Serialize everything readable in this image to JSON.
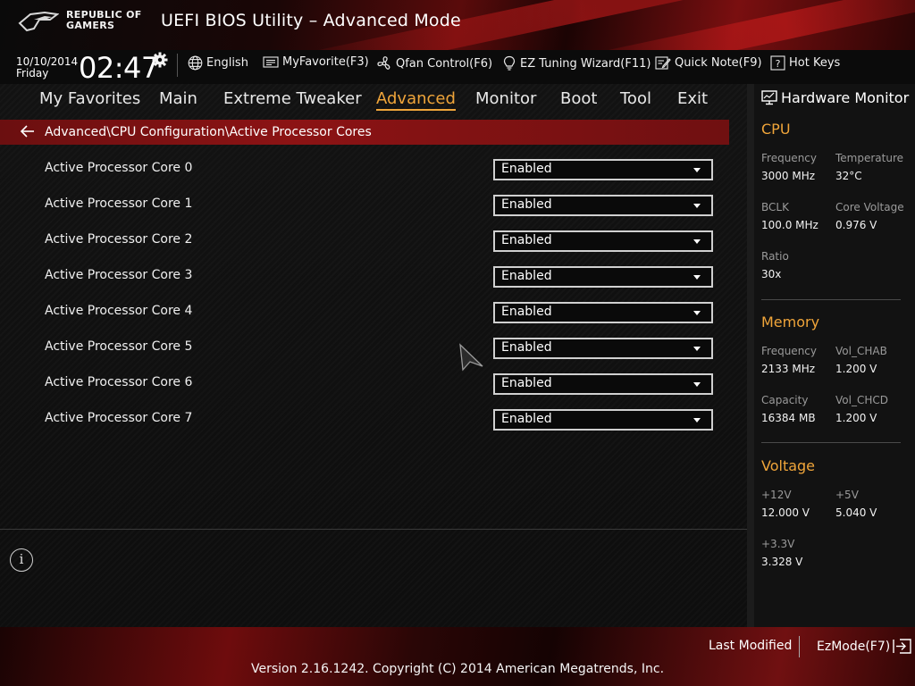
{
  "header": {
    "logo_line1": "REPUBLIC OF",
    "logo_line2": "GAMERS",
    "title": "UEFI BIOS Utility – Advanced Mode"
  },
  "infobar": {
    "date": "10/10/2014",
    "day": "Friday",
    "time": "02:47",
    "tools": [
      {
        "label": "English",
        "icon": "globe-icon"
      },
      {
        "label": "MyFavorite(F3)",
        "icon": "favorite-icon"
      },
      {
        "label": "Qfan Control(F6)",
        "icon": "fan-icon"
      },
      {
        "label": "EZ Tuning Wizard(F11)",
        "icon": "bulb-icon"
      },
      {
        "label": "Quick Note(F9)",
        "icon": "note-icon"
      },
      {
        "label": "Hot Keys",
        "icon": "question-icon"
      }
    ]
  },
  "nav": {
    "tabs": [
      {
        "label": "My Favorites"
      },
      {
        "label": "Main"
      },
      {
        "label": "Extreme Tweaker"
      },
      {
        "label": "Advanced",
        "active": true
      },
      {
        "label": "Monitor"
      },
      {
        "label": "Boot"
      },
      {
        "label": "Tool"
      },
      {
        "label": "Exit"
      }
    ]
  },
  "breadcrumb": "Advanced\\CPU Configuration\\Active Processor Cores",
  "settings": [
    {
      "label": "Active Processor Core 0",
      "value": "Enabled"
    },
    {
      "label": "Active Processor Core 1",
      "value": "Enabled"
    },
    {
      "label": "Active Processor Core 2",
      "value": "Enabled"
    },
    {
      "label": "Active Processor Core 3",
      "value": "Enabled"
    },
    {
      "label": "Active Processor Core 4",
      "value": "Enabled"
    },
    {
      "label": "Active Processor Core 5",
      "value": "Enabled"
    },
    {
      "label": "Active Processor Core 6",
      "value": "Enabled"
    },
    {
      "label": "Active Processor Core 7",
      "value": "Enabled"
    }
  ],
  "help": {
    "icon": "info-icon",
    "glyph": "i"
  },
  "hardware_monitor": {
    "title": "Hardware Monitor",
    "cpu": {
      "title": "CPU",
      "frequency_label": "Frequency",
      "frequency": "3000 MHz",
      "temperature_label": "Temperature",
      "temperature": "32°C",
      "bclk_label": "BCLK",
      "bclk": "100.0 MHz",
      "core_voltage_label": "Core Voltage",
      "core_voltage": "0.976 V",
      "ratio_label": "Ratio",
      "ratio": "30x"
    },
    "memory": {
      "title": "Memory",
      "frequency_label": "Frequency",
      "frequency": "2133 MHz",
      "vol_chab_label": "Vol_CHAB",
      "vol_chab": "1.200 V",
      "capacity_label": "Capacity",
      "capacity": "16384 MB",
      "vol_chcd_label": "Vol_CHCD",
      "vol_chcd": "1.200 V"
    },
    "voltage": {
      "title": "Voltage",
      "v12_label": "+12V",
      "v12": "12.000 V",
      "v5_label": "+5V",
      "v5": "5.040 V",
      "v33_label": "+3.3V",
      "v33": "3.328 V"
    }
  },
  "footer": {
    "last_modified": "Last Modified",
    "ezmode": "EzMode(F7)",
    "version": "Version 2.16.1242. Copyright (C) 2014 American Megatrends, Inc."
  },
  "colors": {
    "accent": "#f0a53a",
    "brand_red": "#8c1314"
  }
}
